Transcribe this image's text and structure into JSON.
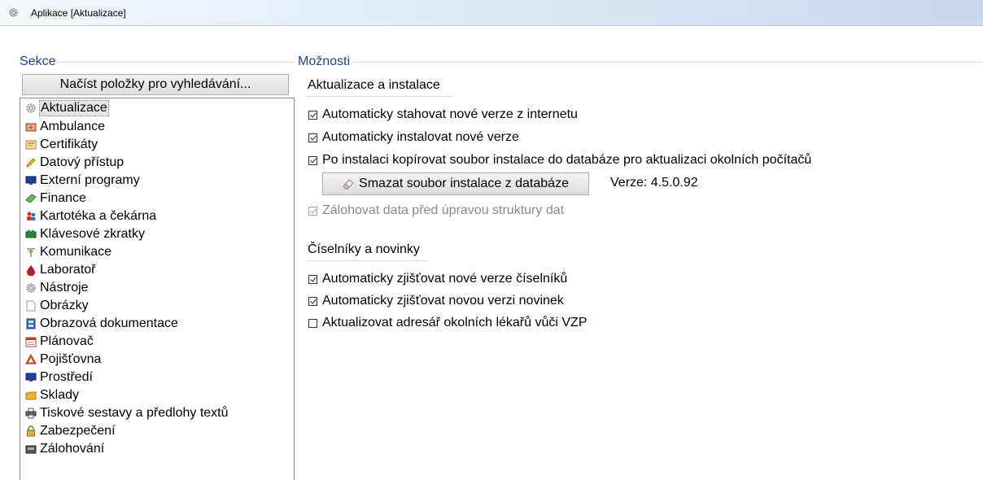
{
  "window": {
    "title": "Aplikace [Aktualizace]",
    "icon": "gear-icon"
  },
  "sections_panel": {
    "label": "Sekce",
    "load_button": "Načíst položky pro vyhledávání...",
    "selected_index": 0,
    "items": [
      {
        "label": "Aktualizace",
        "icon": "gear-icon"
      },
      {
        "label": "Ambulance",
        "icon": "ambulance-icon"
      },
      {
        "label": "Certifikáty",
        "icon": "certificate-icon"
      },
      {
        "label": "Datový přístup",
        "icon": "pencil-icon"
      },
      {
        "label": "Externí programy",
        "icon": "monitor-icon"
      },
      {
        "label": "Finance",
        "icon": "money-icon"
      },
      {
        "label": "Kartotéka a čekárna",
        "icon": "people-icon"
      },
      {
        "label": "Klávesové zkratky",
        "icon": "keyboard-icon"
      },
      {
        "label": "Komunikace",
        "icon": "antenna-icon"
      },
      {
        "label": "Laboratoř",
        "icon": "blood-drop-icon"
      },
      {
        "label": "Nástroje",
        "icon": "tools-gear-icon"
      },
      {
        "label": "Obrázky",
        "icon": "image-page-icon"
      },
      {
        "label": "Obrazová dokumentace",
        "icon": "film-icon"
      },
      {
        "label": "Plánovač",
        "icon": "calendar-icon"
      },
      {
        "label": "Pojišťovna",
        "icon": "insurance-icon"
      },
      {
        "label": "Prostředí",
        "icon": "monitor-icon"
      },
      {
        "label": "Sklady",
        "icon": "folder-icon"
      },
      {
        "label": "Tiskové sestavy a předlohy textů",
        "icon": "printer-icon"
      },
      {
        "label": "Zabezpečení",
        "icon": "lock-icon"
      },
      {
        "label": "Zálohování",
        "icon": "disk-icon"
      }
    ]
  },
  "options_panel": {
    "label": "Možnosti",
    "updates": {
      "title": "Aktualizace a instalace",
      "download_auto": {
        "label": "Automaticky stahovat nové verze z internetu",
        "checked": true
      },
      "install_auto": {
        "label": "Automaticky instalovat nové verze",
        "checked": true
      },
      "copy_to_db": {
        "label": "Po instalaci kopírovat soubor instalace do databáze pro aktualizaci okolních počítačů",
        "checked": true
      },
      "delete_button": "Smazat soubor instalace z databáze",
      "version_text": "Verze: 4.5.0.92",
      "backup_before": {
        "label": "Zálohovat data před úpravou struktury dat",
        "checked": true,
        "disabled": true
      }
    },
    "codelists": {
      "title": "Číselníky a novinky",
      "codelist_versions": {
        "label": "Automaticky zjišťovat nové verze číselníků",
        "checked": true
      },
      "news_version": {
        "label": "Automaticky zjišťovat novou verzi novinek",
        "checked": true
      },
      "vzp_directory": {
        "label": "Aktualizovat adresář okolních lékařů vůči VZP",
        "checked": false
      }
    }
  }
}
